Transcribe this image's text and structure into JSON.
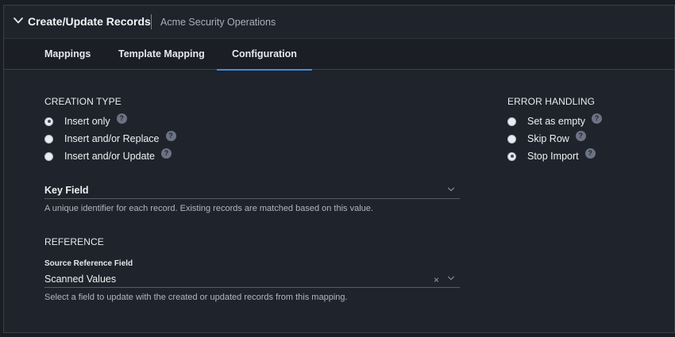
{
  "header": {
    "title": "Create/Update Records",
    "subtitle": "Acme Security Operations"
  },
  "tabs": [
    {
      "label": "Mappings",
      "active": false
    },
    {
      "label": "Template Mapping",
      "active": false
    },
    {
      "label": "Configuration",
      "active": true
    }
  ],
  "creation_type": {
    "title": "CREATION TYPE",
    "options": [
      {
        "label": "Insert only",
        "checked": true
      },
      {
        "label": "Insert and/or Replace",
        "checked": false
      },
      {
        "label": "Insert and/or Update",
        "checked": false
      }
    ]
  },
  "error_handling": {
    "title": "ERROR HANDLING",
    "options": [
      {
        "label": "Set as empty",
        "checked": false
      },
      {
        "label": "Skip Row",
        "checked": false
      },
      {
        "label": "Stop Import",
        "checked": true
      }
    ]
  },
  "key_field": {
    "value": "Key Field",
    "helper": "A unique identifier for each record. Existing records are matched based on this value."
  },
  "reference": {
    "title": "REFERENCE",
    "field_label": "Source Reference Field",
    "value": "Scanned Values",
    "clear_symbol": "×",
    "helper": "Select a field to update with the created or updated records from this mapping."
  },
  "help_symbol": "?",
  "colors": {
    "accent": "#3b8de0",
    "background": "#1f232b",
    "help_icon": "#6b7384"
  },
  "icons": {
    "collapse": "chevron-down-icon",
    "help": "help-circle-icon",
    "dropdown": "chevron-down-icon",
    "clear": "close-icon"
  }
}
